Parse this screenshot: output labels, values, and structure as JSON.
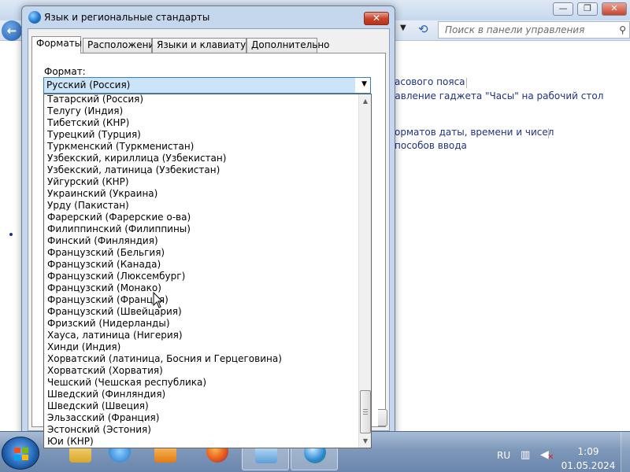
{
  "control_panel": {
    "search_placeholder": "Поиск в панели управления",
    "window_buttons": {
      "minimize": "—",
      "maximize": "❐",
      "close": "✕"
    },
    "links": [
      "асового пояса",
      "бавление гаджета \"Часы\" на рабочий стол",
      "орматов даты, времени и чисел",
      "пособов ввода"
    ]
  },
  "dialog": {
    "title": "Язык и региональные стандарты",
    "close_label": "✕",
    "tabs": [
      "Форматы",
      "Расположение",
      "Языки и клавиатуры",
      "Дополнительно"
    ],
    "active_tab": 0,
    "format_label": "Формат:",
    "format_value": "Русский (Россия)",
    "dropdown_items": [
      "Татарский (Россия)",
      "Телугу (Индия)",
      "Тибетский (КНР)",
      "Турецкий (Турция)",
      "Туркменский (Туркменистан)",
      "Узбекский, кириллица (Узбекистан)",
      "Узбекский, латиница (Узбекистан)",
      "Уйгурский (КНР)",
      "Украинский (Украина)",
      "Урду (Пакистан)",
      "Фарерский (Фарерские о-ва)",
      "Филиппинский (Филиппины)",
      "Финский (Финляндия)",
      "Французский (Бельгия)",
      "Французский (Канада)",
      "Французский (Люксембург)",
      "Французский (Монако)",
      "Французский (Франция)",
      "Французский (Швейцария)",
      "Фризский (Нидерланды)",
      "Хауса, латиница (Нигерия)",
      "Хинди (Индия)",
      "Хорватский (латиница, Босния и Герцеговина)",
      "Хорватский (Хорватия)",
      "Чешский (Чешская республика)",
      "Шведский (Финляндия)",
      "Шведский (Швеция)",
      "Эльзасский (Франция)",
      "Эстонский (Эстония)",
      "Юи (КНР)",
      "Юи (КНР)"
    ]
  },
  "taskbar": {
    "apps": [
      "explorer-icon",
      "ie-icon",
      "media-player-icon",
      "firefox-icon",
      "control-panel-icon",
      "region-settings-icon"
    ],
    "active_apps": [
      4,
      5
    ],
    "language": "RU",
    "time": "1:09",
    "date": "01.05.2024"
  }
}
